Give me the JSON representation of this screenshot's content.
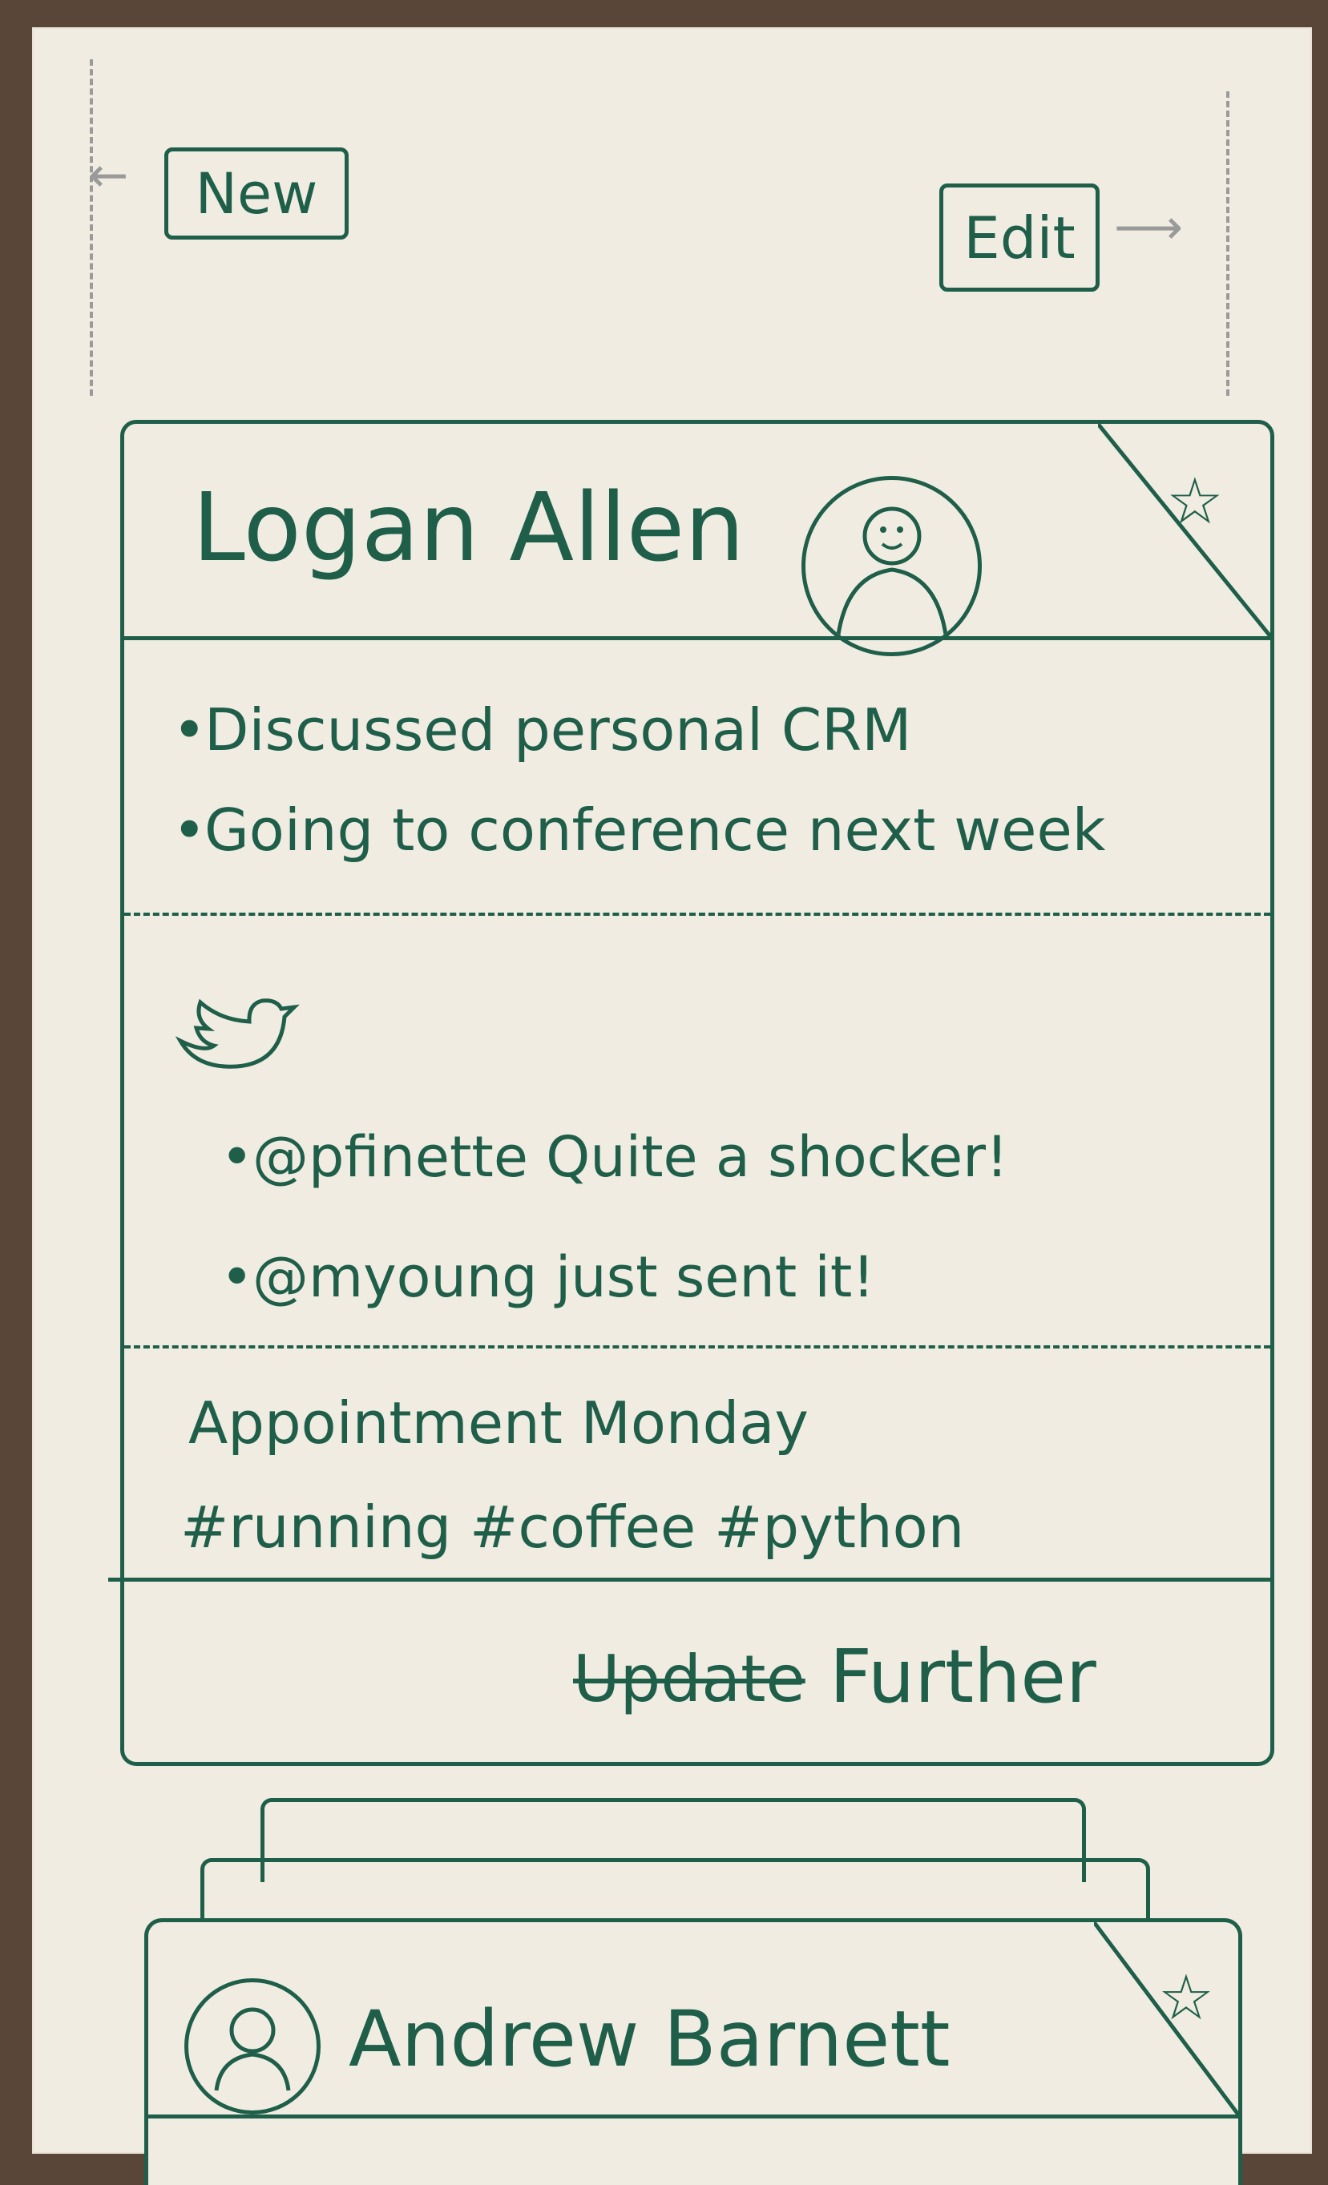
{
  "toolbar": {
    "new_label": "New",
    "edit_label": "Edit"
  },
  "card": {
    "name": "Logan Allen",
    "notes": [
      "Discussed personal CRM",
      "Going to conference next week"
    ],
    "tweets": [
      "@pfinette Quite a shocker!",
      "@myoung just sent it!"
    ],
    "appointment": "Appointment Monday",
    "tags": "#running #coffee #python",
    "footer_struck": "Update",
    "footer_action": "Further"
  },
  "next_card": {
    "name": "Andrew Barnett"
  },
  "icons": [
    "star-icon",
    "avatar-icon",
    "twitter-icon"
  ],
  "colors": {
    "ink": "#1f5f4a",
    "paper": "#f0ece2",
    "table": "#5a4638"
  }
}
